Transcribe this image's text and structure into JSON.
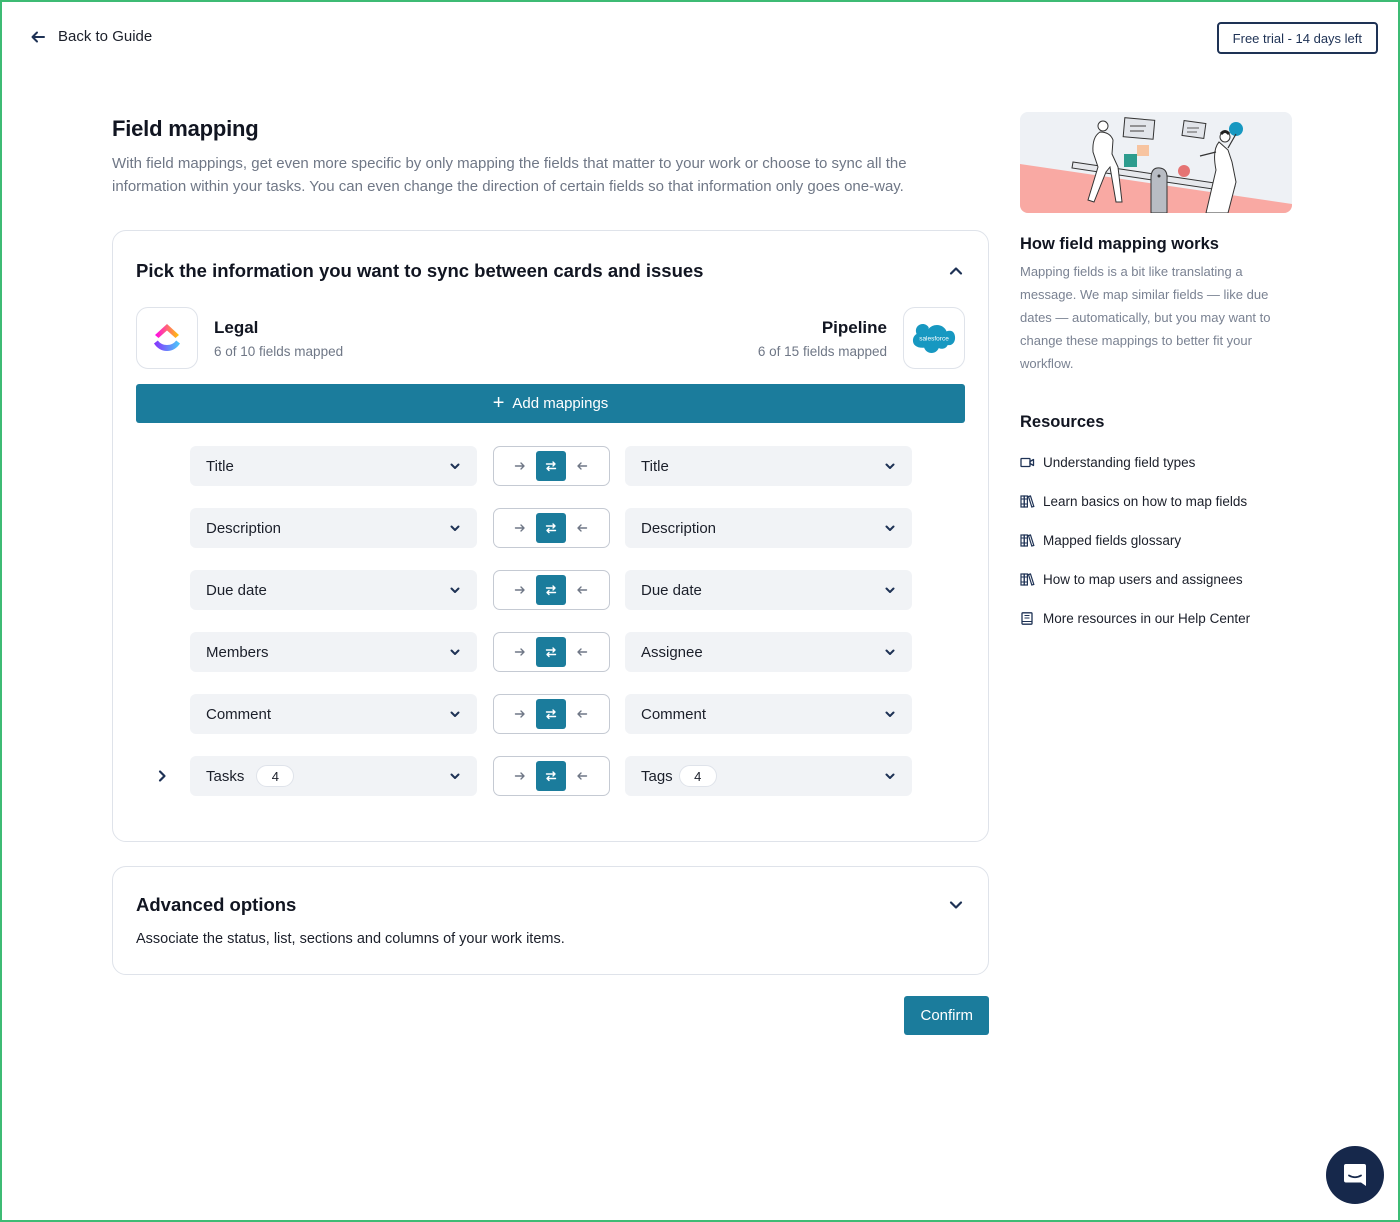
{
  "topbar": {
    "back_label": "Back to Guide",
    "trial_label": "Free trial - 14 days left"
  },
  "main": {
    "title": "Field mapping",
    "description": "With field mappings, get even more specific by only mapping the fields that matter to your work or choose to sync all the information within your tasks. You can even change the direction of certain fields so that information only goes one-way.",
    "mapping_card": {
      "title": "Pick the information you want to sync between cards and issues",
      "left_app": {
        "name": "Legal",
        "count": "6 of 10 fields mapped",
        "logo": "clickup-logo"
      },
      "right_app": {
        "name": "Pipeline",
        "count": "6 of 15 fields mapped",
        "logo": "salesforce-logo",
        "logo_text": "salesforce"
      },
      "add_label": "Add mappings",
      "rows": [
        {
          "left": "Title",
          "right": "Title",
          "direction": "both"
        },
        {
          "left": "Description",
          "right": "Description",
          "direction": "both"
        },
        {
          "left": "Due date",
          "right": "Due date",
          "direction": "both"
        },
        {
          "left": "Members",
          "right": "Assignee",
          "direction": "both"
        },
        {
          "left": "Comment",
          "right": "Comment",
          "direction": "both"
        },
        {
          "left": "Tasks",
          "left_count": "4",
          "right": "Tags",
          "right_count": "4",
          "direction": "both",
          "expandable": true
        }
      ]
    },
    "advanced": {
      "title": "Advanced options",
      "description": "Associate the status, list, sections and columns of your work items."
    },
    "confirm_label": "Confirm"
  },
  "side": {
    "how_title": "How field mapping works",
    "how_desc": "Mapping fields is a bit like translating a message. We map similar fields — like due dates — automatically, but you may want to change these mappings to better fit your workflow.",
    "resources_title": "Resources",
    "resources": [
      {
        "label": "Understanding field types",
        "icon": "video-icon"
      },
      {
        "label": "Learn basics on how to map fields",
        "icon": "books-icon"
      },
      {
        "label": "Mapped fields glossary",
        "icon": "books-icon"
      },
      {
        "label": "How to map users and assignees",
        "icon": "books-icon"
      },
      {
        "label": "More resources in our Help Center",
        "icon": "book-icon"
      }
    ]
  },
  "colors": {
    "accent": "#1b7c9c",
    "navy": "#1e3255",
    "chat_bg": "#16284b"
  }
}
